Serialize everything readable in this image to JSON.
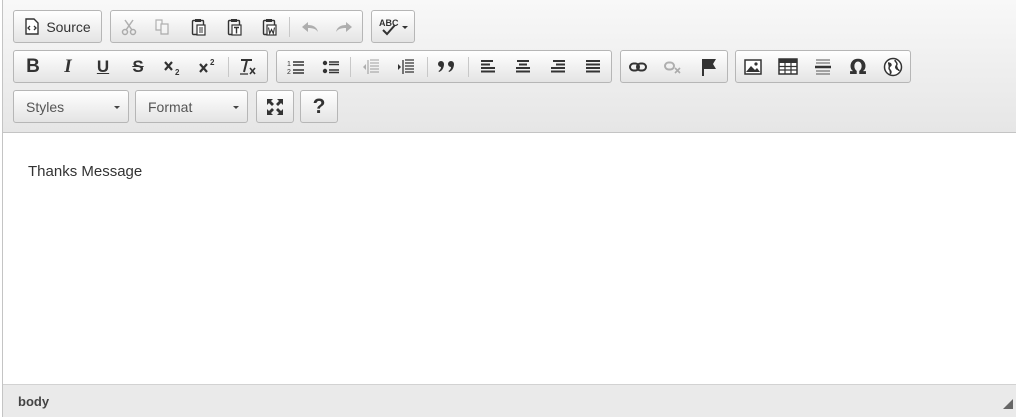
{
  "toolbar": {
    "source_label": "Source",
    "styles_combo": "Styles",
    "format_combo": "Format",
    "help_label": "?",
    "bold": "B",
    "italic": "I",
    "underline": "U",
    "strike": "S",
    "omega": "Ω"
  },
  "content": {
    "text": "Thanks Message"
  },
  "statusbar": {
    "path": "body"
  },
  "icons": [
    "source-icon",
    "cut-icon",
    "copy-icon",
    "paste-icon",
    "paste-text-icon",
    "paste-word-icon",
    "undo-icon",
    "redo-icon",
    "spellcheck-icon",
    "bold-icon",
    "italic-icon",
    "underline-icon",
    "strikethrough-icon",
    "subscript-icon",
    "superscript-icon",
    "remove-format-icon",
    "numbered-list-icon",
    "bulleted-list-icon",
    "outdent-icon",
    "indent-icon",
    "blockquote-icon",
    "align-left-icon",
    "align-center-icon",
    "align-right-icon",
    "justify-icon",
    "link-icon",
    "unlink-icon",
    "anchor-icon",
    "image-icon",
    "table-icon",
    "horizontal-line-icon",
    "special-char-icon",
    "iframe-icon",
    "maximize-icon",
    "help-icon"
  ]
}
